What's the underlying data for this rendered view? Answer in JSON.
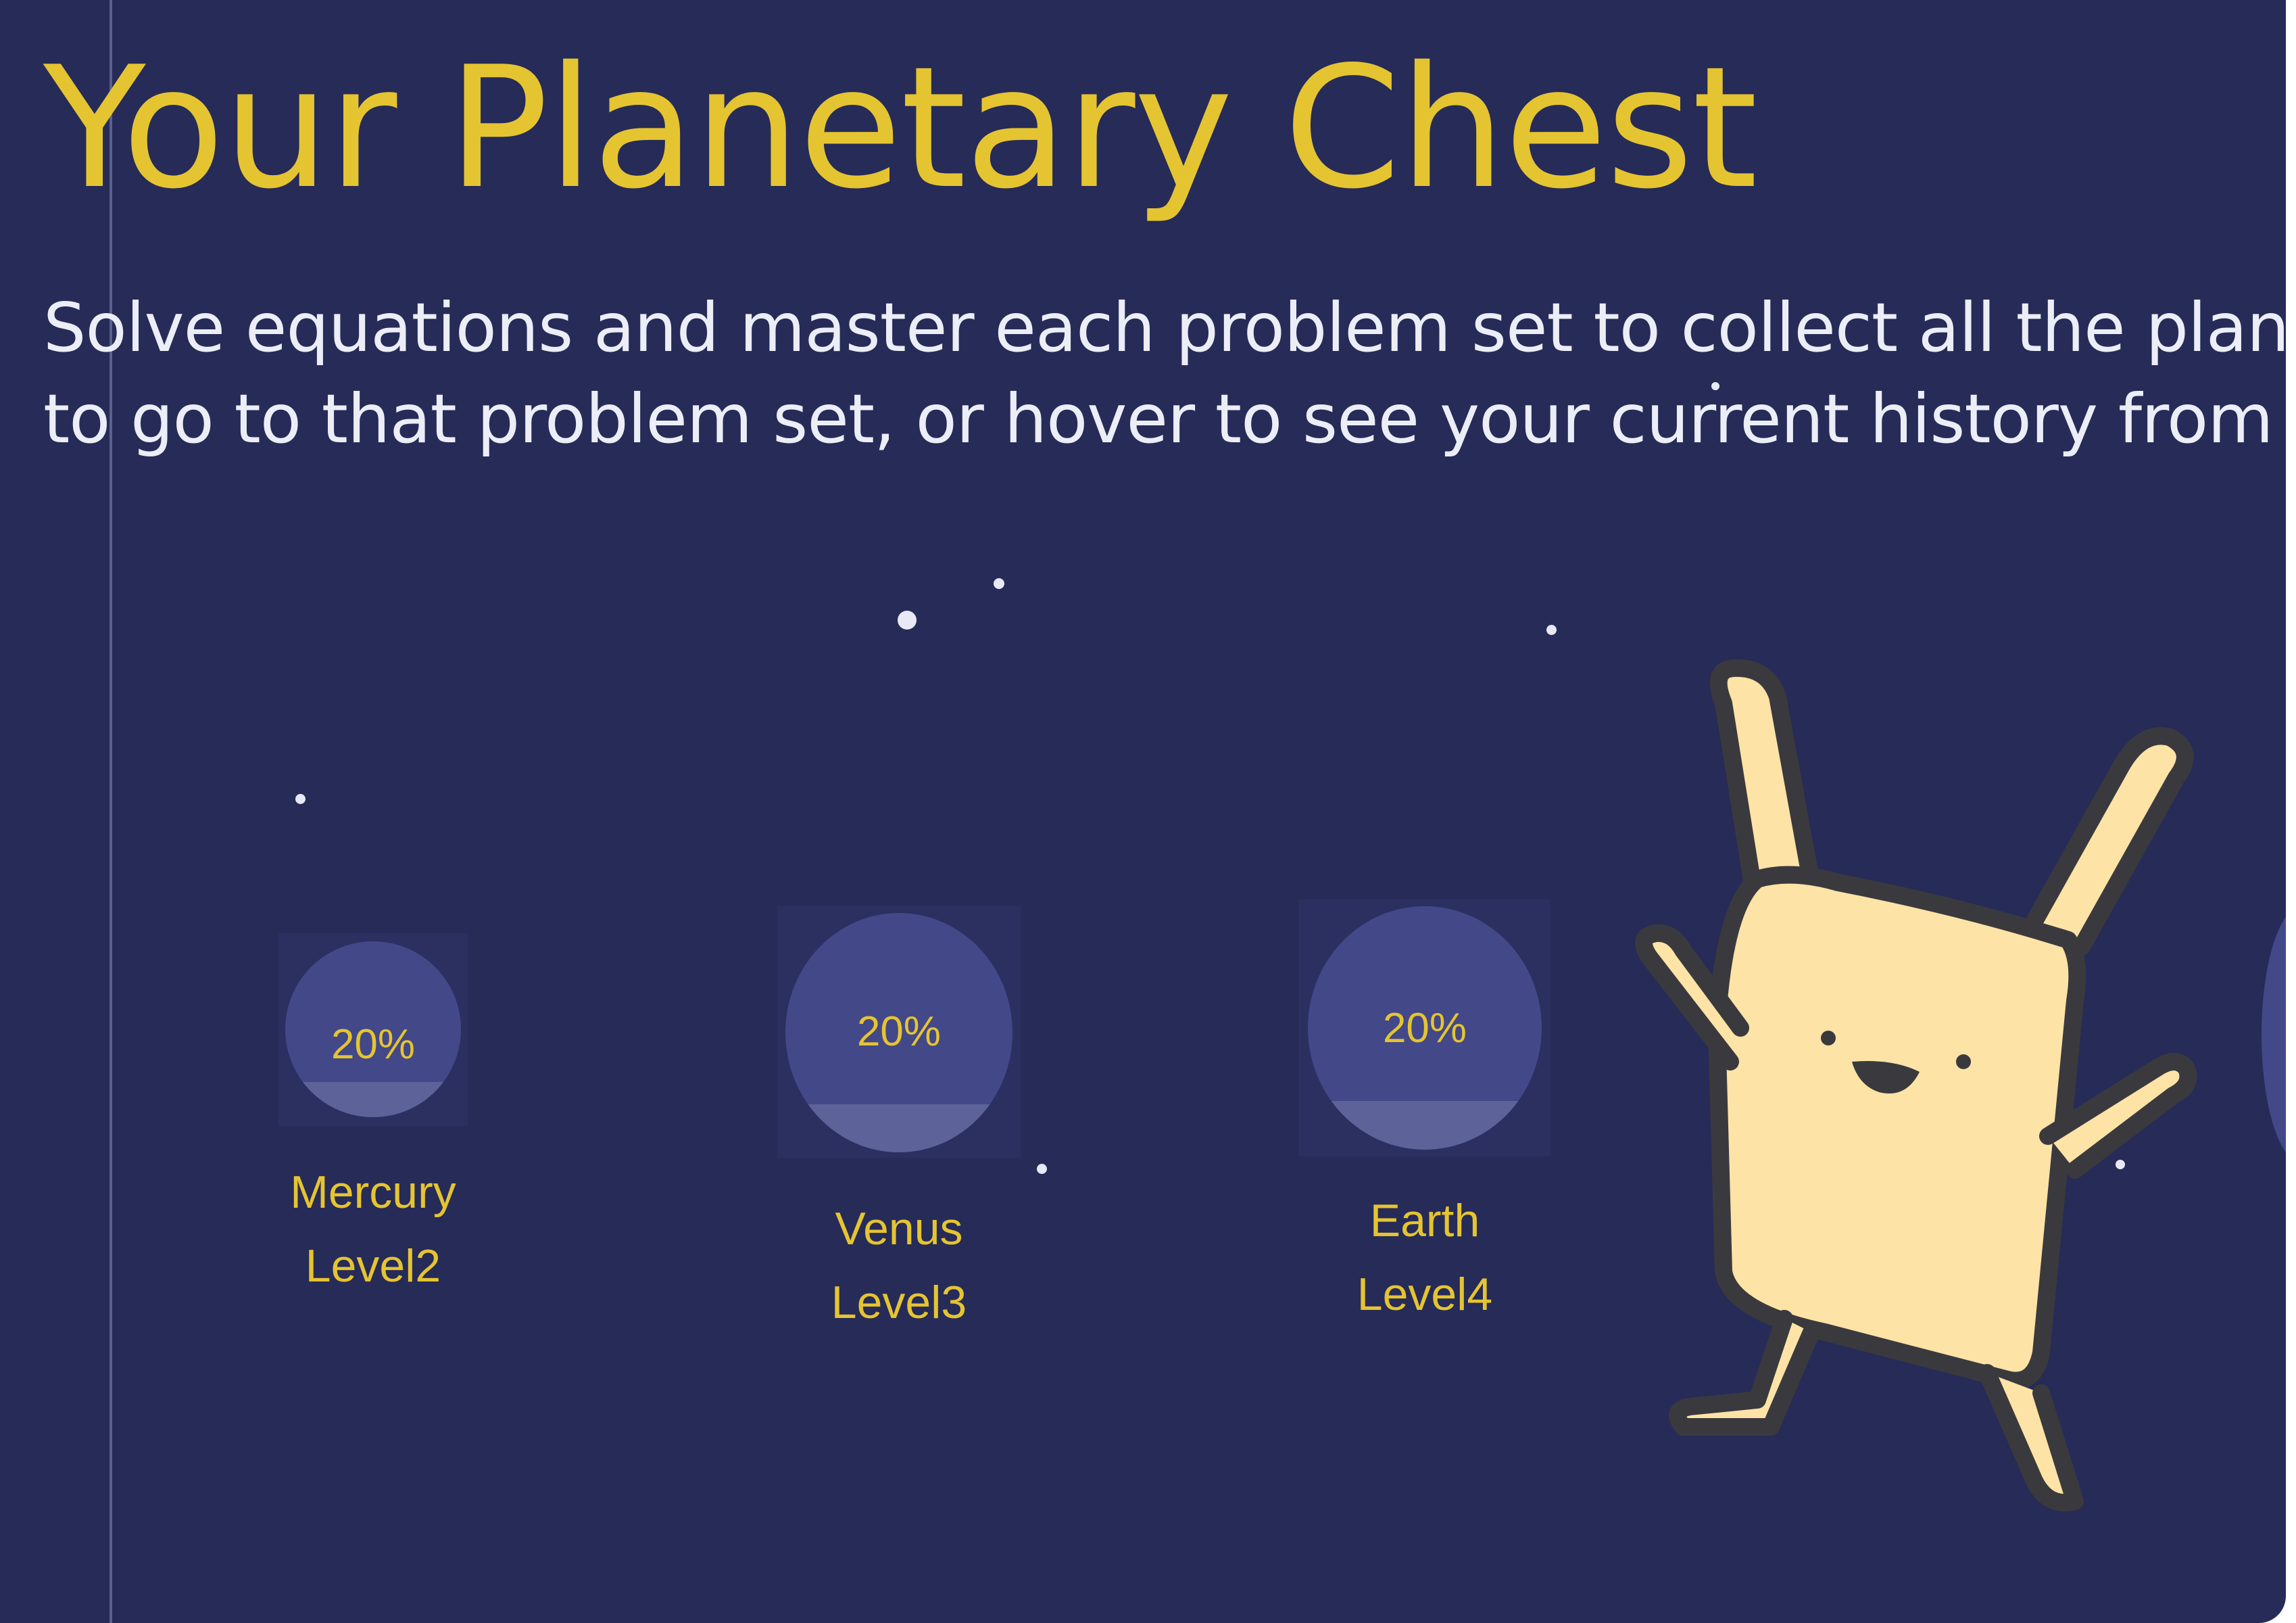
{
  "page": {
    "title": "Your Planetary Chest",
    "subtitle_line1": "Solve equations and master each problem set to collect all the planets!",
    "subtitle_line2": "to go to that problem set, or hover to see your current history from that"
  },
  "colors": {
    "background": "#262b58",
    "accent": "#e5c431",
    "text": "#eceef7",
    "planet": "#424888",
    "planet_progress": "#5d6399",
    "mascot": "#fde3a6"
  },
  "planets": [
    {
      "name": "Mercury",
      "level": "Level2",
      "percent_label": "20%",
      "progress": 0.2
    },
    {
      "name": "Venus",
      "level": "Level3",
      "percent_label": "20%",
      "progress": 0.2
    },
    {
      "name": "Earth",
      "level": "Level4",
      "percent_label": "20%",
      "progress": 0.2
    }
  ],
  "mascot": {
    "icon": "cheering-creature-icon"
  }
}
